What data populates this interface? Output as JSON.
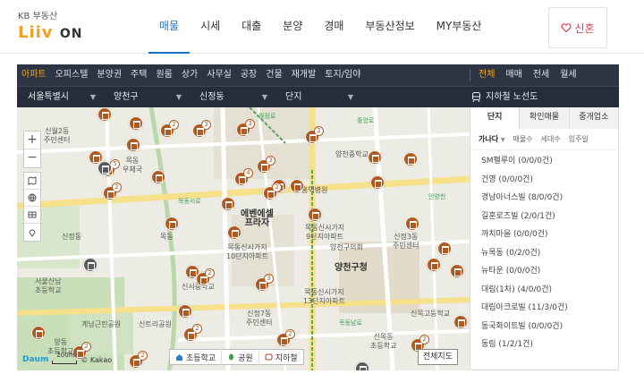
{
  "header": {
    "logo_top": "KB 부동산",
    "logo_brand": "Liiv",
    "logo_suffix": "ON",
    "nav": [
      "매물",
      "시세",
      "대출",
      "분양",
      "경매",
      "부동산정보",
      "MY부동산"
    ],
    "newlywed_label": "신혼"
  },
  "filters": {
    "property_types": [
      "아파트",
      "오피스텔",
      "분양권",
      "주택",
      "원룸",
      "상가",
      "사무실",
      "공장",
      "건물",
      "재개발",
      "토지/임야"
    ],
    "deal_types": [
      "전체",
      "매매",
      "전세",
      "월세"
    ],
    "regions": [
      "서울특별시",
      "양천구",
      "신정동",
      "단지"
    ],
    "subway_label": "지하철 노선도"
  },
  "map": {
    "labels": {
      "apt_area": "목동신시가지\n9단지아파트",
      "plaza": "에벤에셀\n프라자",
      "office": "양천구청",
      "council": "양천구의회",
      "hospital": "홍익병원",
      "center": "신정3동\n주민센터",
      "center2": "신정7동\n주민센터",
      "complex13": "목동신시가지\n13단지아파트",
      "complex10": "목동신시가지\n10단지아파트",
      "complex2": "신서중학교",
      "school1": "신목동\n초등학교",
      "school2": "양천중학교",
      "school3": "신목고등학교",
      "rd1": "월정로",
      "rd2": "목동서로",
      "rd3": "중앙로",
      "rd4": "목동남로",
      "rd5": "안양천",
      "rd6": "오목로",
      "complex_mok": "목동",
      "sinwol": "신월2동\n주민센터",
      "sinwol_market": "목동\n우체국",
      "sinjeong": "신정동",
      "seoul_park": "계남근린공원",
      "sinjeong_cross": "신트리공원",
      "elem1": "서울신남\n초등학교",
      "elem2": "양동\n초등학교"
    },
    "legend": [
      "초등학교",
      "공원",
      "지하철"
    ],
    "whole_map_label": "전체지도",
    "scale_label": "200m",
    "provider": "Daum",
    "provider2": "© Kakao",
    "pin_counts": [
      "2",
      "3",
      "3",
      "2",
      "4",
      "3",
      "5",
      "2",
      "2",
      "2",
      "3",
      "2",
      "2",
      "2",
      "2",
      "2",
      "2",
      "2"
    ]
  },
  "panel": {
    "tabs": [
      "단지",
      "확인매물",
      "중개업소"
    ],
    "sorts": [
      "가나다",
      "매물수",
      "세대수",
      "입주일"
    ],
    "complexes": [
      "SM펠루이 (0/0/0건)",
      "건영 (0/0/0건)",
      "경남아너스빌 (8/0/0건)",
      "길훈로즈빌 (2/0/1건)",
      "까치마을 (0/0/0건)",
      "뉴목동 (0/2/0건)",
      "뉴타운 (0/0/0건)",
      "대림(1차) (4/0/0건)",
      "대림아크로빌 (11/3/0건)",
      "동국화이트빌 (0/0/0건)",
      "동림 (1/2/1건)"
    ]
  },
  "colors": {
    "accent": "#1a73c8",
    "highlight": "#f3a51d",
    "pin": "#b15a1f",
    "bar": "#2d3544"
  }
}
